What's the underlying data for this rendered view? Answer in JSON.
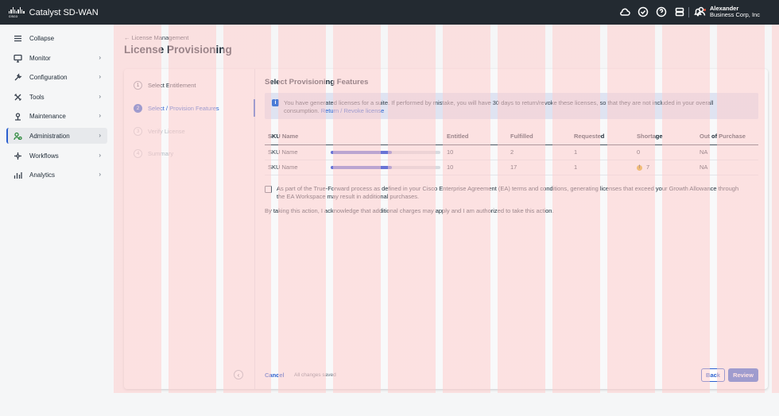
{
  "app": {
    "brand": "cisco",
    "title": "Catalyst SD-WAN"
  },
  "header_icons": [
    "cloud-icon",
    "check-circle-icon",
    "help-icon",
    "server-icon",
    "bell-icon"
  ],
  "user": {
    "name": "Alexander",
    "org": "Business Corp, Inc"
  },
  "sidebar": {
    "items": [
      {
        "label": "Collapse",
        "icon": "menu-icon"
      },
      {
        "label": "Monitor",
        "icon": "monitor-icon"
      },
      {
        "label": "Configuration",
        "icon": "configuration-icon"
      },
      {
        "label": "Tools",
        "icon": "tools-icon"
      },
      {
        "label": "Maintenance",
        "icon": "maintenance-icon"
      },
      {
        "label": "Administration",
        "icon": "administration-icon",
        "active": true
      },
      {
        "label": "Workflows",
        "icon": "workflows-icon"
      },
      {
        "label": "Analytics",
        "icon": "analytics-icon"
      }
    ]
  },
  "breadcrumb": {
    "back_label": "License Management"
  },
  "page_title": "License Provisioning",
  "steps": [
    {
      "num": "1",
      "label": "Select Entitlement",
      "state": "done"
    },
    {
      "num": "2",
      "label": "Select / Provision Features",
      "state": "current"
    },
    {
      "num": "3",
      "label": "Verify License",
      "state": "pending"
    },
    {
      "num": "4",
      "label": "Summary",
      "state": "pending"
    }
  ],
  "section_title": "Select Provisioning Features",
  "banner": {
    "text": "You have generated licenses for a suite. If performed by mistake, you will have 30 days to return/revoke these licenses, so that they are not included in your overall consumption.",
    "link": "Return / Revoke license"
  },
  "table": {
    "headers": [
      "SKU Name",
      "Entitled",
      "Fulfilled",
      "Requested",
      "Shortage",
      "Out of Purchase"
    ],
    "rows": [
      {
        "sku": "SKU Name",
        "progress": 0.56,
        "entitled": "10",
        "fulfilled": "2",
        "requested": "1",
        "shortage": "0",
        "shortage_warning": false,
        "out_of_purchase": "NA"
      },
      {
        "sku": "SKU Name",
        "progress": 0.56,
        "entitled": "10",
        "fulfilled": "17",
        "requested": "1",
        "shortage": "7",
        "shortage_warning": true,
        "out_of_purchase": "NA"
      }
    ]
  },
  "agreement": {
    "checkbox_text": "As part of the True-Forward process as defined in your Cisco Enterprise Agreement (EA) terms and conditions, generating licenses that exceed your Growth Allowance through the EA Workspace may result in additional purchases.",
    "checked": false
  },
  "acknowledgement": "By taking this action, I acknowledge that additional charges may apply and I am authorized to take this action.",
  "footer": {
    "cancel": "Cancel",
    "status": "All changes saved",
    "back": "Back",
    "review": "Review"
  },
  "colors": {
    "accent": "#2b5fcf",
    "topbar": "#232a31",
    "progress": "#6874d6",
    "warning": "#e0a610"
  }
}
